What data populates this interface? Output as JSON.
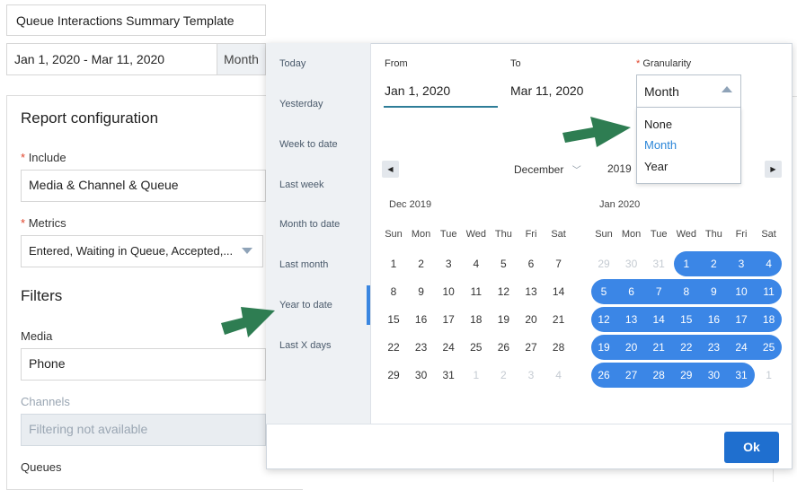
{
  "report": {
    "template_name": "Queue Interactions Summary Template",
    "date_range": "Jan 1, 2020 - Mar 11, 2020",
    "granularity_tag": "Month"
  },
  "config": {
    "title": "Report configuration",
    "required_mark": "*",
    "include_label": "Include",
    "include_value": "Media & Channel & Queue",
    "metrics_label": "Metrics",
    "metrics_value": "Entered, Waiting in Queue, Accepted,...",
    "filters_title": "Filters",
    "media_label": "Media",
    "media_value": "Phone",
    "channels_label": "Channels",
    "channels_value": "Filtering not available",
    "queues_label": "Queues"
  },
  "picker": {
    "presets": [
      "Today",
      "Yesterday",
      "Week to date",
      "Last week",
      "Month to date",
      "Last month",
      "Year to date",
      "Last X days"
    ],
    "active_preset": "Year to date",
    "from_label": "From",
    "from_value": "Jan 1, 2020",
    "to_label": "To",
    "to_value": "Mar 11, 2020",
    "granularity_label": "Granularity",
    "granularity_value": "Month",
    "granularity_options": [
      "None",
      "Month",
      "Year"
    ],
    "granularity_selected": "Month",
    "nav_month": "December",
    "nav_year": "2019",
    "ok_label": "Ok",
    "weekdays": [
      "Sun",
      "Mon",
      "Tue",
      "Wed",
      "Thu",
      "Fri",
      "Sat"
    ],
    "calendars": [
      {
        "title": "Dec 2019",
        "weeks": [
          [
            "1",
            "2",
            "3",
            "4",
            "5",
            "6",
            "7"
          ],
          [
            "8",
            "9",
            "10",
            "11",
            "12",
            "13",
            "14"
          ],
          [
            "15",
            "16",
            "17",
            "18",
            "19",
            "20",
            "21"
          ],
          [
            "22",
            "23",
            "24",
            "25",
            "26",
            "27",
            "28"
          ],
          [
            "29",
            "30",
            "31",
            "1",
            "2",
            "3",
            "4"
          ]
        ],
        "muted": [
          [],
          [],
          [],
          [],
          [
            3,
            4,
            5,
            6
          ]
        ],
        "selected_weeks": []
      },
      {
        "title": "Jan 2020",
        "weeks": [
          [
            "29",
            "30",
            "31",
            "1",
            "2",
            "3",
            "4"
          ],
          [
            "5",
            "6",
            "7",
            "8",
            "9",
            "10",
            "11"
          ],
          [
            "12",
            "13",
            "14",
            "15",
            "16",
            "17",
            "18"
          ],
          [
            "19",
            "20",
            "21",
            "22",
            "23",
            "24",
            "25"
          ],
          [
            "26",
            "27",
            "28",
            "29",
            "30",
            "31",
            "1"
          ]
        ],
        "muted": [
          [
            0,
            1,
            2
          ],
          [],
          [],
          [],
          [
            6
          ]
        ],
        "selected_weeks": [
          [
            3,
            6
          ],
          [
            0,
            6
          ],
          [
            0,
            6
          ],
          [
            0,
            6
          ],
          [
            0,
            5
          ]
        ]
      }
    ]
  },
  "colors": {
    "accent": "#3b86e6",
    "ok_button": "#1f6fcf",
    "required": "#e0442b",
    "arrow": "#2e7d52"
  },
  "annotations": [
    "arrow-to-granularity-dropdown",
    "arrow-to-year-to-date"
  ]
}
